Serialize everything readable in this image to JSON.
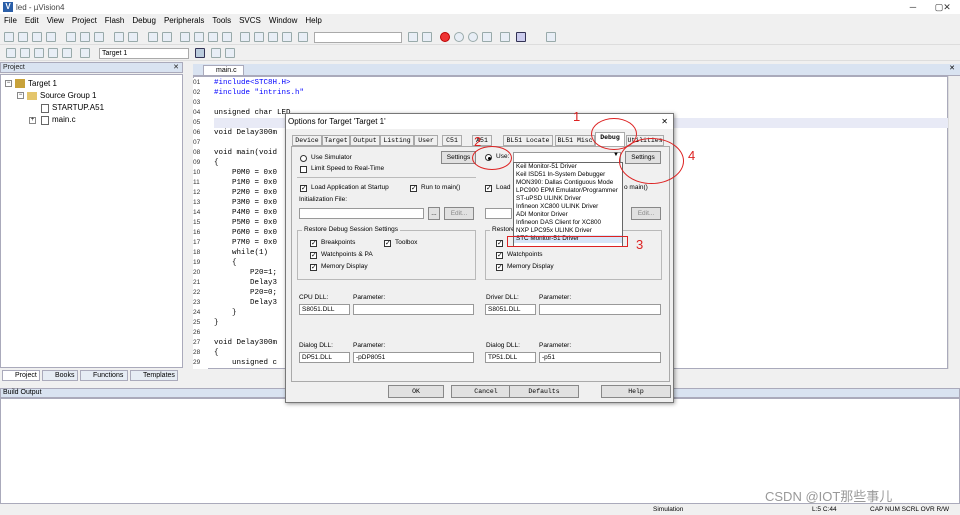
{
  "window": {
    "title": "led - µVision4",
    "minimize": "─",
    "maximize": "▢",
    "close": "✕"
  },
  "menus": [
    "File",
    "Edit",
    "View",
    "Project",
    "Flash",
    "Debug",
    "Peripherals",
    "Tools",
    "SVCS",
    "Window",
    "Help"
  ],
  "toolbar": {
    "target": "Target 1"
  },
  "project_panel": {
    "title": "Project",
    "tree": [
      "Target 1",
      "Source Group 1",
      "STARTUP.A51",
      "main.c"
    ],
    "tabs": [
      "Project",
      "Books",
      "Functions",
      "Templates"
    ]
  },
  "editor": {
    "tab": "main.c",
    "line_numbers": [
      "01",
      "02",
      "03",
      "04",
      "05",
      "06",
      "07",
      "08",
      "09",
      "10",
      "11",
      "12",
      "13",
      "14",
      "15",
      "16",
      "17",
      "18",
      "19",
      "20",
      "21",
      "22",
      "23",
      "24",
      "25",
      "26",
      "27",
      "28",
      "29"
    ],
    "lines": [
      "#include<STC8H.H>",
      "#include \"intrins.h\"",
      "",
      "unsigned char LED",
      "",
      "void Delay300m",
      "",
      "void main(void",
      "{",
      "    P0M0 = 0x0",
      "    P1M0 = 0x0",
      "    P2M0 = 0x0",
      "    P3M0 = 0x0",
      "    P4M0 = 0x0",
      "    P5M0 = 0x0",
      "    P6M0 = 0x0",
      "    P7M0 = 0x0",
      "    while(1)",
      "    {",
      "        P20=1;",
      "        Delay3",
      "        P20=0;",
      "        Delay3",
      "    }",
      "}",
      "",
      "void Delay300m",
      "{",
      "    unsigned c"
    ]
  },
  "dialog": {
    "title": "Options for Target 'Target 1'",
    "close": "✕",
    "tabs": [
      "Device",
      "Target",
      "Output",
      "Listing",
      "User",
      "C51",
      "A51",
      "BL51 Locate",
      "BL51 Misc",
      "Debug",
      "Utilities"
    ],
    "left": {
      "use_simulator": "Use Simulator",
      "limit_speed": "Limit Speed to Real-Time",
      "settings": "Settings",
      "load_app": "Load Application at Startup",
      "run_to_main": "Run to main()",
      "init_file": "Initialization File:",
      "edit": "Edit...",
      "browse": "...",
      "restore": "Restore Debug Session Settings",
      "breakpoints": "Breakpoints",
      "toolbox": "Toolbox",
      "watchpoints": "Watchpoints & PA",
      "memory_display": "Memory Display",
      "cpu_dll": "CPU DLL:",
      "cpu_param": "Parameter:",
      "cpu_dll_value": "S8051.DLL",
      "cpu_param_value": "",
      "dialog_dll": "Dialog DLL:",
      "dialog_param": "Parameter:",
      "dialog_dll_value": "DP51.DLL",
      "dialog_param_value": "-pDP8051"
    },
    "right": {
      "use": "Use:",
      "settings": "Settings",
      "load": "Load",
      "run_to_main": "o main()",
      "init_label": "Initialization File:",
      "edit": "Edit...",
      "browse": "...",
      "restore": "Restore",
      "watchpoints": "Watchpoints",
      "memory_display": "Memory Display",
      "driver_dll": "Driver DLL:",
      "driver_param": "Parameter:",
      "driver_dll_value": "S8051.DLL",
      "driver_param_value": "",
      "dialog_dll": "Dialog DLL:",
      "dialog_param": "Parameter:",
      "dialog_dll_value": "TP51.DLL",
      "dialog_param_value": "-p51"
    },
    "dropdown": [
      "Keil Monitor-51 Driver",
      "Keil ISD51 In-System Debugger",
      "MON390: Dallas Contiguous Mode",
      "LPC900 EPM Emulator/Programmer",
      "ST-uPSD ULINK Driver",
      "Infineon XC800 ULINK Driver",
      "ADI Monitor Driver",
      "Infineon DAS Client for XC800",
      "NXP LPC95x ULINK Driver",
      "STC Monitor-51 Driver"
    ],
    "buttons": {
      "ok": "OK",
      "cancel": "Cancel",
      "defaults": "Defaults",
      "help": "Help"
    }
  },
  "annotations": [
    "1",
    "2",
    "3",
    "4"
  ],
  "build_output": {
    "title": "Build Output"
  },
  "status": {
    "mode": "Simulation",
    "position": "L:5 C:44",
    "indicators": "CAP NUM SCRL OVR R/W"
  },
  "watermark": "CSDN @IOT那些事儿",
  "colors": {
    "accent": "#d22222",
    "panel": "#d9e3f1"
  }
}
